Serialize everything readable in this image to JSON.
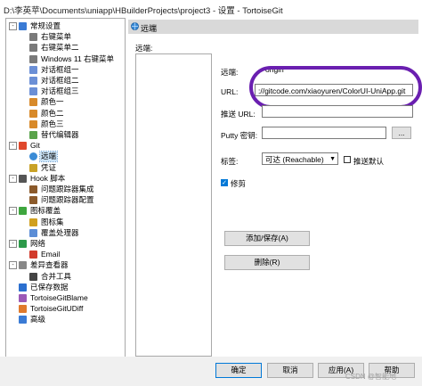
{
  "window": {
    "title": "D:\\李英苹\\Documents\\uniapp\\HBuilderProjects\\project3 - 设置 - TortoiseGit"
  },
  "tree": {
    "items": [
      {
        "label": "常规设置",
        "icon": "wrench-icon",
        "expander": "-"
      },
      {
        "label": "右键菜单",
        "icon": "menu-icon"
      },
      {
        "label": "右键菜单二",
        "icon": "menu-icon"
      },
      {
        "label": "Windows 11 右键菜单",
        "icon": "menu-icon"
      },
      {
        "label": "对话框组一",
        "icon": "dialog-icon"
      },
      {
        "label": "对话框组二",
        "icon": "dialog-icon"
      },
      {
        "label": "对话框组三",
        "icon": "dialog-icon"
      },
      {
        "label": "颜色一",
        "icon": "palette-icon"
      },
      {
        "label": "颜色二",
        "icon": "palette-icon"
      },
      {
        "label": "颜色三",
        "icon": "palette-icon"
      },
      {
        "label": "替代编辑器",
        "icon": "editor-icon"
      },
      {
        "label": "Git",
        "icon": "git-icon",
        "expander": "-"
      },
      {
        "label": "远端",
        "icon": "globe-icon",
        "selected": true
      },
      {
        "label": "凭证",
        "icon": "key-icon"
      },
      {
        "label": "Hook 脚本",
        "icon": "hook-icon",
        "expander": "-"
      },
      {
        "label": "问题跟踪器集成",
        "icon": "bug-icon"
      },
      {
        "label": "问题跟踪器配置",
        "icon": "bug-icon"
      },
      {
        "label": "图标覆盖",
        "icon": "overlay-icon",
        "expander": "-"
      },
      {
        "label": "图标集",
        "icon": "iconset-icon"
      },
      {
        "label": "覆盖处理器",
        "icon": "overlay-handler-icon"
      },
      {
        "label": "网络",
        "icon": "network-icon",
        "expander": "-"
      },
      {
        "label": "Email",
        "icon": "email-icon"
      },
      {
        "label": "差异查看器",
        "icon": "diff-icon",
        "expander": "-"
      },
      {
        "label": "合并工具",
        "icon": "merge-icon"
      },
      {
        "label": "已保存数据",
        "icon": "save-icon"
      },
      {
        "label": "TortoiseGitBlame",
        "icon": "blame-icon"
      },
      {
        "label": "TortoiseGitUDiff",
        "icon": "udiff-icon"
      },
      {
        "label": "高级",
        "icon": "advanced-icon"
      }
    ]
  },
  "page": {
    "header": "远端",
    "remote_group_label": "远端:",
    "remote_label": "远端:",
    "remote_value": "origin",
    "url_label": "URL:",
    "url_value": "://gitcode.com/xiaoyuren/ColorUI-UniApp.git",
    "push_url_label": "推送 URL:",
    "push_url_value": "",
    "putty_label": "Putty 密钥:",
    "putty_value": "",
    "browse_button": "...",
    "tag_label": "标签:",
    "tag_value": "可达 (Reachable)",
    "push_default_label": "推送默认",
    "prune_label": "修剪",
    "add_save_button": "添加/保存(A)",
    "delete_button": "删除(R)"
  },
  "footer": {
    "ok": "确定",
    "cancel": "取消",
    "apply": "应用(A)",
    "help": "帮助"
  },
  "watermark": "CSDN @智能地",
  "colors": {
    "accent": "#0078d7",
    "highlight": "#6a1fb0",
    "header_bg": "#d9d9d9"
  }
}
